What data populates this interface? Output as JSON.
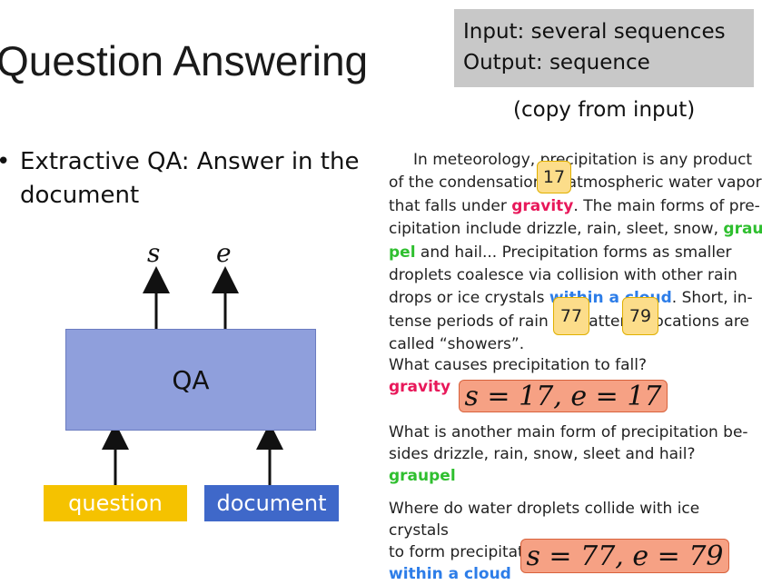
{
  "title": "Question Answering",
  "io": {
    "input_line": "Input: several sequences",
    "output_line": "Output: sequence",
    "note": "(copy from input)"
  },
  "bullet": {
    "dot": "•",
    "text": "Extractive QA: Answer in the document"
  },
  "diagram": {
    "output_s": "s",
    "output_e": "e",
    "model_label": "QA",
    "input_question": "question",
    "input_document": "document",
    "colors": {
      "model": "#8f9fdc",
      "question": "#f5c200",
      "document": "#3f68c9"
    }
  },
  "document": {
    "lines": [
      [
        "    In meteorology, precipitation is any product"
      ],
      [
        "of the condensation of atmospheric water vapor"
      ],
      [
        "that falls under ",
        "gravity",
        ". The main forms of pre-"
      ],
      [
        "cipitation include drizzle, rain, sleet, snow, ",
        "grau-"
      ],
      [
        "pel",
        " and hail...  Precipitation forms as smaller"
      ],
      [
        "droplets coalesce via collision with other rain"
      ],
      [
        "drops or ice crystals ",
        "within a cloud",
        ". Short, in-"
      ],
      [
        "tense periods of rain in scattered locations are"
      ],
      [
        "called “showers”."
      ]
    ],
    "highlights": {
      "gravity": "#e8185a",
      "graupel": "#2fbf2f",
      "within a cloud": "#2d7de8"
    }
  },
  "token_tags": {
    "t17": "17",
    "t77": "77",
    "t79": "79"
  },
  "questions": [
    {
      "question": "What causes precipitation to fall?",
      "answer": "gravity",
      "span": "s = 17, e = 17"
    },
    {
      "question": "What is another main form of precipitation be- sides drizzle, rain, snow, sleet and hail?",
      "answer": "graupel",
      "span": ""
    },
    {
      "question": "Where do water droplets collide with ice crystals to form precipitation?",
      "answer": "within a cloud",
      "span": "s = 77, e = 79"
    }
  ]
}
